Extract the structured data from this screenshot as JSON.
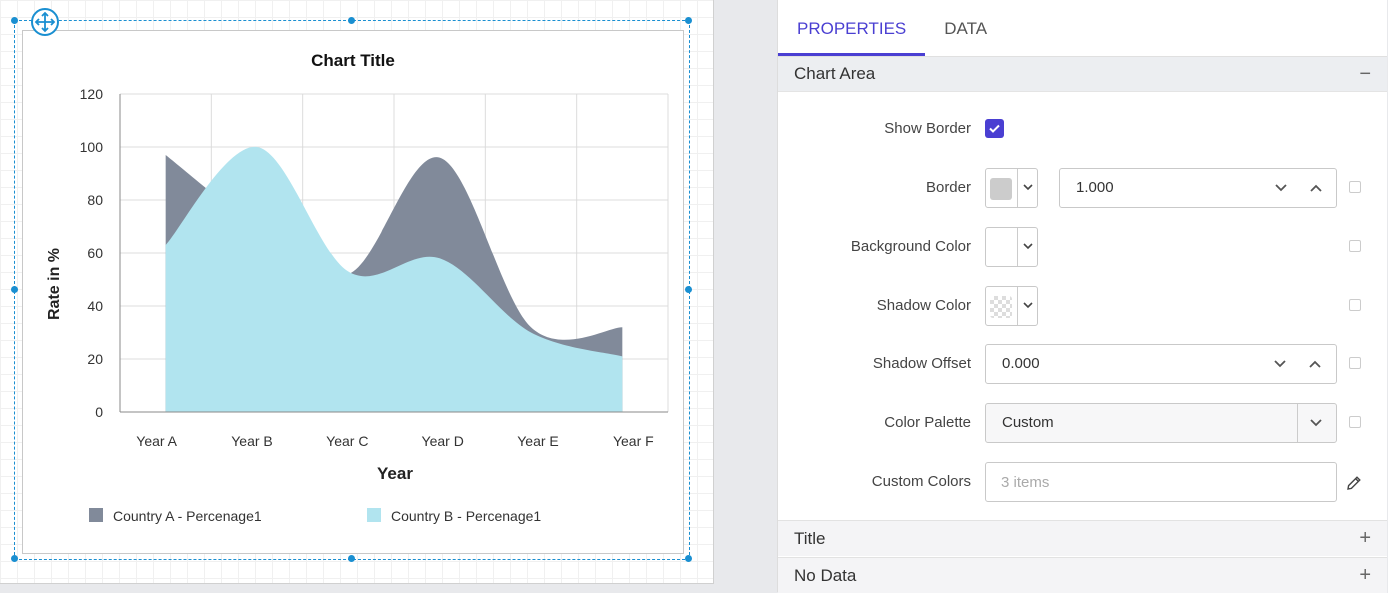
{
  "designer": {
    "chart": {
      "title": "Chart Title",
      "ylabel": "Rate in %",
      "xlabel": "Year",
      "legend": [
        {
          "label": "Country A - Percenage1",
          "color": "#818a9a"
        },
        {
          "label": "Country B - Percenage1",
          "color": "#b1e4ef"
        }
      ]
    }
  },
  "chart_data": {
    "type": "area",
    "title": "Chart Title",
    "xlabel": "Year",
    "ylabel": "Rate in %",
    "categories": [
      "Year A",
      "Year B",
      "Year C",
      "Year D",
      "Year E",
      "Year F"
    ],
    "ylim": [
      0,
      120
    ],
    "yticks": [
      0,
      20,
      40,
      60,
      80,
      100,
      120
    ],
    "grid": true,
    "legend_position": "bottom",
    "series": [
      {
        "name": "Country A - Percenage1",
        "color": "#818a9a",
        "values": [
          97,
          70,
          52,
          96,
          32,
          32
        ]
      },
      {
        "name": "Country B - Percenage1",
        "color": "#b1e4ef",
        "values": [
          63,
          100,
          53,
          58,
          30,
          21
        ]
      }
    ]
  },
  "panel": {
    "tabs": [
      {
        "label": "PROPERTIES",
        "active": true
      },
      {
        "label": "DATA",
        "active": false
      }
    ],
    "section": {
      "title": "Chart Area",
      "toggle": "−"
    },
    "fields": {
      "show_border": {
        "label": "Show Border",
        "checked": true
      },
      "border": {
        "label": "Border",
        "color": "#cccccc",
        "value": "1.000"
      },
      "background_color": {
        "label": "Background Color",
        "color": "#ffffff"
      },
      "shadow_color": {
        "label": "Shadow Color",
        "color": "transparent"
      },
      "shadow_offset": {
        "label": "Shadow Offset",
        "value": "0.000"
      },
      "color_palette": {
        "label": "Color Palette",
        "value": "Custom"
      },
      "custom_colors": {
        "label": "Custom Colors",
        "placeholder": "3 items"
      }
    },
    "collapsed_sections": [
      {
        "title": "Title",
        "toggle": "+"
      },
      {
        "title": "No Data",
        "toggle": "+"
      }
    ]
  },
  "colors": {
    "accent": "#4a3fd2",
    "selection": "#1a8fd1"
  }
}
